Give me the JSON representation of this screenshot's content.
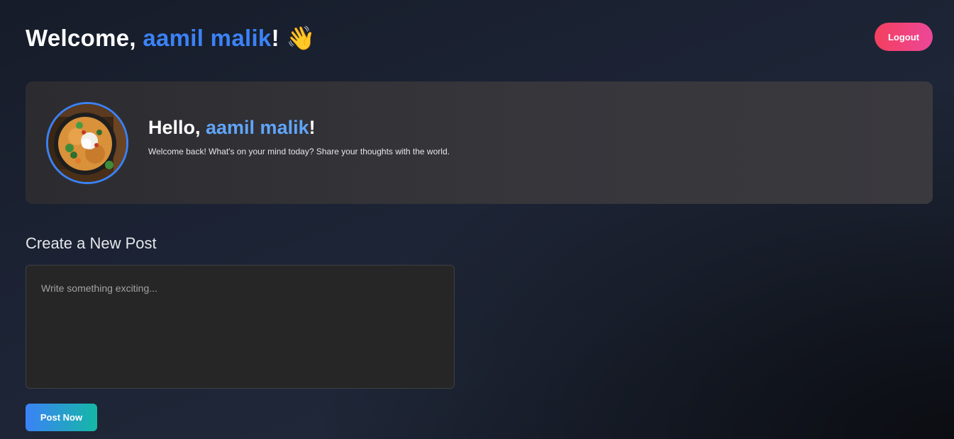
{
  "header": {
    "welcome_prefix": "Welcome, ",
    "username": "aamil malik",
    "welcome_suffix": "!",
    "wave_emoji": "👋",
    "logout_label": "Logout"
  },
  "profile_card": {
    "avatar_icon": "food-bowl-avatar",
    "hello_prefix": "Hello, ",
    "username": "aamil malik",
    "hello_suffix": "!",
    "subtitle": "Welcome back! What's on your mind today? Share your thoughts with the world."
  },
  "create_post": {
    "title": "Create a New Post",
    "placeholder": "Write something exciting...",
    "value": "",
    "submit_label": "Post Now"
  },
  "colors": {
    "accent_blue": "#3b82f6",
    "logout_gradient_start": "#f43f5e",
    "logout_gradient_end": "#ec4899",
    "post_gradient_start": "#3b82f6",
    "post_gradient_end": "#14b8a6"
  }
}
